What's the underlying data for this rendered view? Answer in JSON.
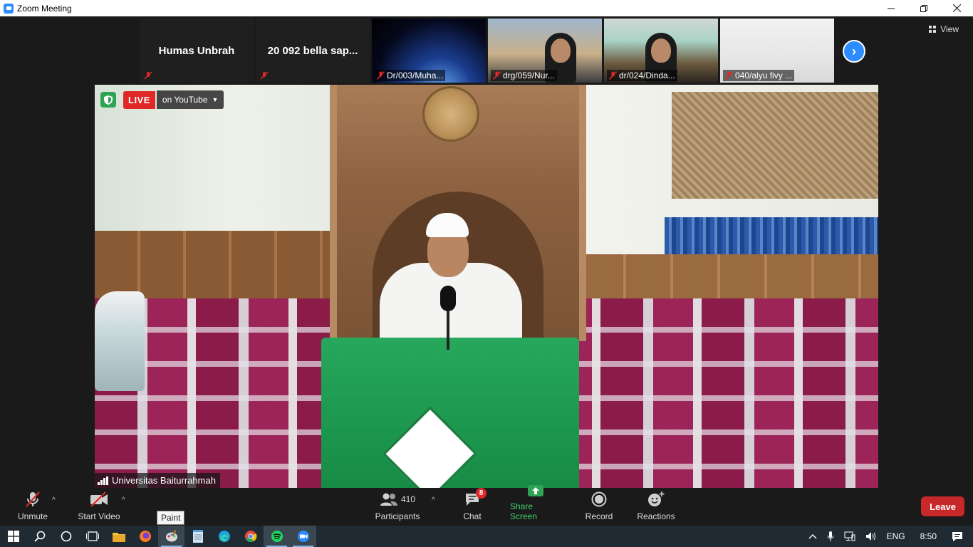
{
  "window": {
    "title": "Zoom Meeting",
    "controls": [
      "minimize",
      "restore",
      "close"
    ]
  },
  "gallery": {
    "participants": [
      {
        "name": "Humas Unbrah",
        "video": false,
        "muted": true
      },
      {
        "name": "20 092 bella sap...",
        "video": false,
        "muted": true
      },
      {
        "name": "Dr/003/Muha...",
        "video": true,
        "muted": true
      },
      {
        "name": "drg/059/Nur...",
        "video": true,
        "muted": true
      },
      {
        "name": "dr/024/Dinda...",
        "video": true,
        "muted": true
      },
      {
        "name": "040/alyu fivy ...",
        "video": true,
        "muted": true
      }
    ],
    "view_label": "View"
  },
  "speaker": {
    "name": "Universitas Baiturrahmah",
    "live_label": "LIVE",
    "live_target": "on YouTube"
  },
  "toolbar": {
    "unmute": "Unmute",
    "start_video": "Start Video",
    "participants": "Participants",
    "participants_count": "410",
    "chat": "Chat",
    "chat_badge": "8",
    "share_screen": "Share Screen",
    "record": "Record",
    "reactions": "Reactions",
    "leave": "Leave"
  },
  "tooltip": "Paint",
  "taskbar": {
    "apps": [
      "start",
      "search",
      "task-view",
      "multitasking",
      "file-explorer",
      "firefox",
      "paint",
      "notepad",
      "edge",
      "chrome",
      "spotify",
      "zoom"
    ],
    "language": "ENG",
    "time": "8:50"
  },
  "colors": {
    "accent_blue": "#2d8cff",
    "leave_red": "#c8282a",
    "share_green": "#3ed16b",
    "live_red": "#e02828"
  }
}
